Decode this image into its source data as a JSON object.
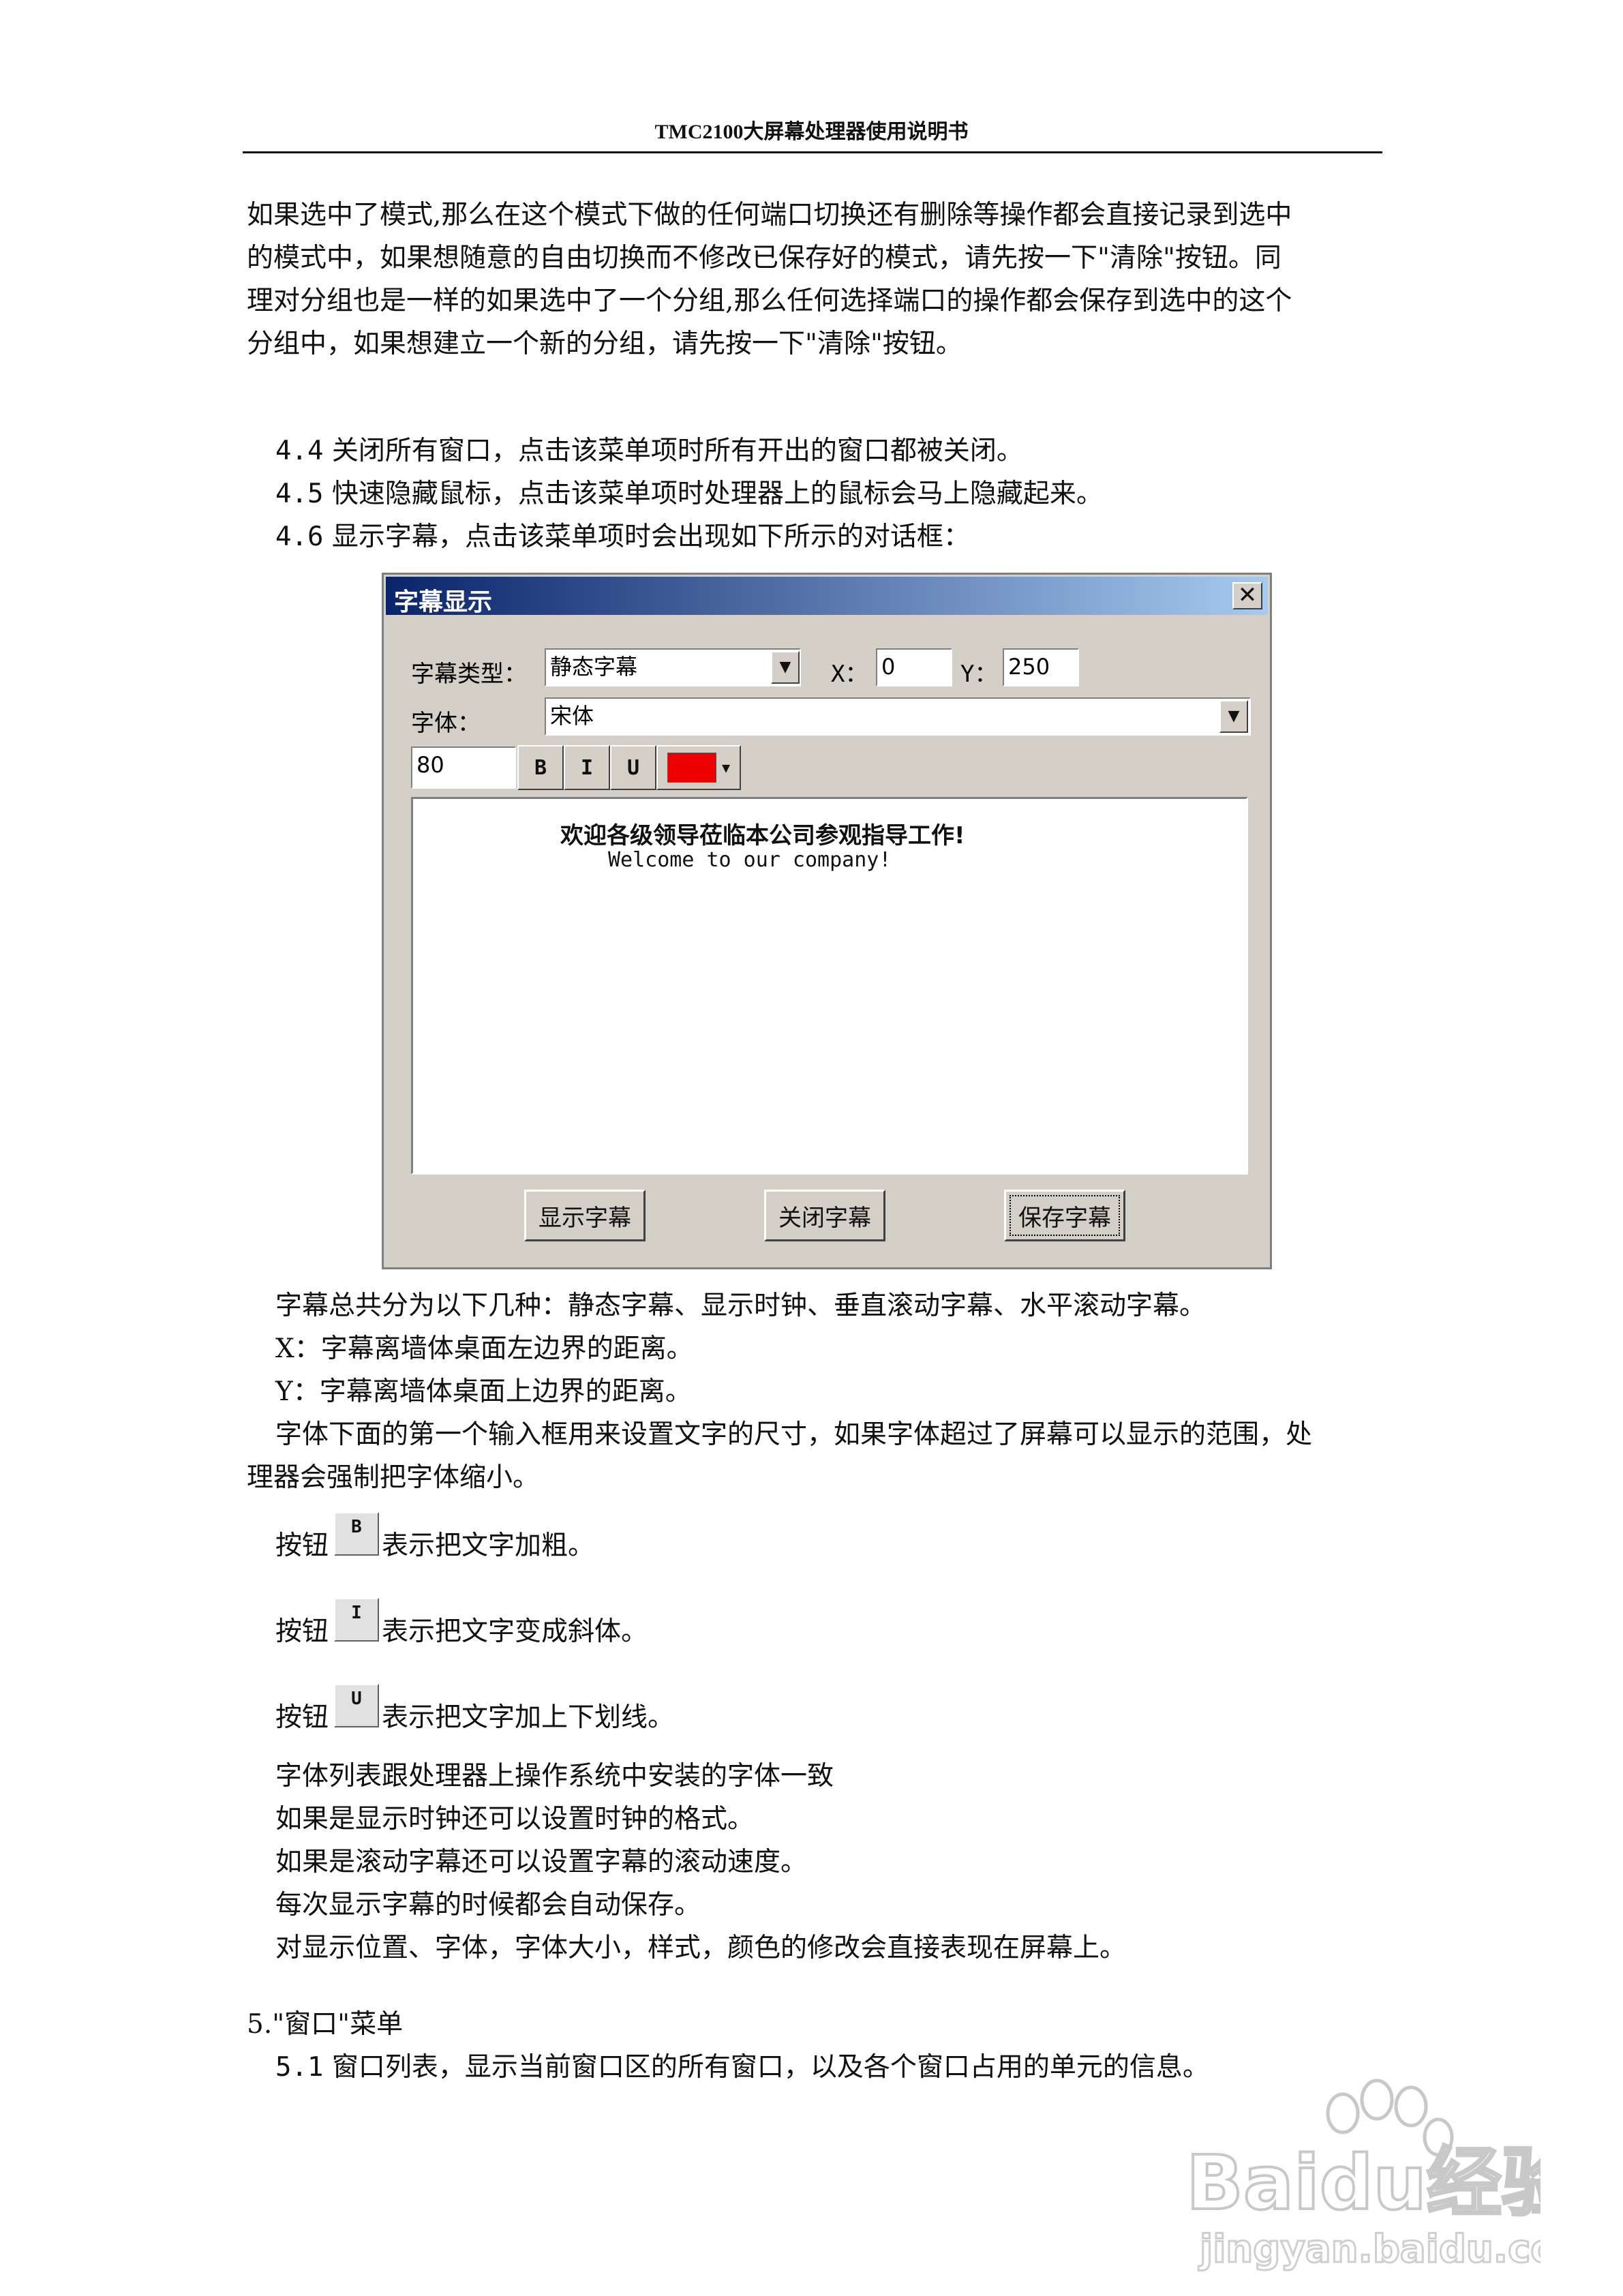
{
  "header": {
    "title": "TMC2100大屏幕处理器使用说明书"
  },
  "intro_lines": [
    "如果选中了模式,那么在这个模式下做的任何端口切换还有删除等操作都会直接记录到选中",
    "的模式中，如果想随意的自由切换而不修改已保存好的模式，请先按一下\"清除\"按钮。同",
    "理对分组也是一样的如果选中了一个分组,那么任何选择端口的操作都会保存到选中的这个",
    "分组中，如果想建立一个新的分组，请先按一下\"清除\"按钮。"
  ],
  "menu_items": [
    {
      "num": "4.4",
      "text": "关闭所有窗口，点击该菜单项时所有开出的窗口都被关闭。"
    },
    {
      "num": "4.5",
      "text": "快速隐藏鼠标，点击该菜单项时处理器上的鼠标会马上隐藏起来。"
    },
    {
      "num": "4.6",
      "text": "显示字幕，点击该菜单项时会出现如下所示的对话框："
    }
  ],
  "dialog": {
    "title": "字幕显示",
    "close": "✕",
    "type_label": "字幕类型：",
    "type_value": "静态字幕",
    "x_label": "X：",
    "x_value": "0",
    "y_label": "Y：",
    "y_value": "250",
    "font_label": "字体：",
    "font_value": "宋体",
    "size_value": "80",
    "bold": "B",
    "italic": "I",
    "underline": "U",
    "color": "#ee0000",
    "text_line1": "欢迎各级领导莅临本公司参观指导工作!",
    "text_line2": "Welcome to our company!",
    "btn_show": "显示字幕",
    "btn_close": "关闭字幕",
    "btn_save": "保存字幕"
  },
  "desc_lines": [
    "字幕总共分为以下几种：静态字幕、显示时钟、垂直滚动字幕、水平滚动字幕。",
    "X：字幕离墙体桌面左边界的距离。",
    "Y：字幕离墙体桌面上边界的距离。",
    "字体下面的第一个输入框用来设置文字的尺寸，如果字体超过了屏幕可以显示的范围，处",
    "理器会强制把字体缩小。"
  ],
  "button_notes": [
    {
      "prefix": "按钮",
      "btn": "B",
      "text": "表示把文字加粗。"
    },
    {
      "prefix": "按钮",
      "btn": "I",
      "text": "表示把文字变成斜体。"
    },
    {
      "prefix": "按钮",
      "btn": "U",
      "text": "表示把文字加上下划线。"
    }
  ],
  "notes": [
    "字体列表跟处理器上操作系统中安装的字体一致",
    "如果是显示时钟还可以设置时钟的格式。",
    "如果是滚动字幕还可以设置字幕的滚动速度。",
    "每次显示字幕的时候都会自动保存。",
    "对显示位置、字体，字体大小，样式，颜色的修改会直接表现在屏幕上。"
  ],
  "section5": {
    "heading": "5.\"窗口\"菜单",
    "item_num": "5.1",
    "item_text": "窗口列表，显示当前窗口区的所有窗口，以及各个窗口占用的单元的信息。"
  },
  "watermark": {
    "brand": "Baidu经验",
    "url": "jingyan.baidu.com"
  }
}
